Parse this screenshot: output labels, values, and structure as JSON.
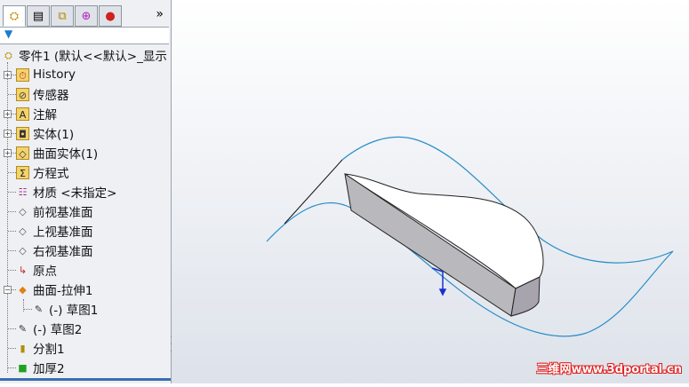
{
  "toolbar": {
    "more": "»"
  },
  "filter": {
    "icon": "filter-icon"
  },
  "tree": {
    "root": "零件1  (默认<<默认>_显示",
    "items": [
      {
        "label": "History",
        "icon": "history-icon",
        "expandable": true
      },
      {
        "label": "传感器",
        "icon": "sensor-icon",
        "expandable": false
      },
      {
        "label": "注解",
        "icon": "annotation-icon",
        "expandable": true
      },
      {
        "label": "实体(1)",
        "icon": "solid-bodies-icon",
        "expandable": true
      },
      {
        "label": "曲面实体(1)",
        "icon": "surface-bodies-icon",
        "expandable": true
      },
      {
        "label": "方程式",
        "icon": "equations-icon",
        "expandable": false
      },
      {
        "label": "材质 <未指定>",
        "icon": "material-icon",
        "expandable": false
      },
      {
        "label": "前视基准面",
        "icon": "plane-icon",
        "expandable": false
      },
      {
        "label": "上视基准面",
        "icon": "plane-icon",
        "expandable": false
      },
      {
        "label": "右视基准面",
        "icon": "plane-icon",
        "expandable": false
      },
      {
        "label": "原点",
        "icon": "origin-icon",
        "expandable": false
      },
      {
        "label": "曲面-拉伸1",
        "icon": "surface-extrude-icon",
        "expandable": true
      },
      {
        "label": "(-) 草图1",
        "icon": "sketch-icon",
        "expandable": false
      },
      {
        "label": "(-) 草图2",
        "icon": "sketch-icon",
        "expandable": false
      },
      {
        "label": "分割1",
        "icon": "split-icon",
        "expandable": false
      },
      {
        "label": "加厚2",
        "icon": "thicken-icon",
        "expandable": false
      }
    ]
  },
  "watermark": "三维网www.3dportal.cn",
  "colors": {
    "surface": "#2a8ec8",
    "body": "#b8b8bc",
    "accent": "#3a6db0"
  }
}
